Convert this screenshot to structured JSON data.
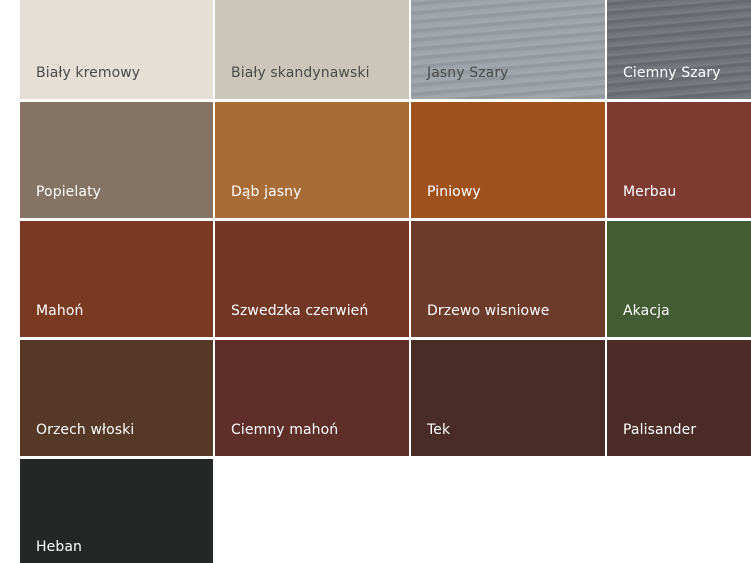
{
  "swatches": [
    {
      "name": "Biały kremowy",
      "color": "#e6dfd5",
      "text_color": "#4a4a4a"
    },
    {
      "name": "Biały skandynawski",
      "color": "#cbc5ba",
      "text_color": "#4a4a4a"
    },
    {
      "name": "Jasny Szary",
      "color": "#9aa0a6",
      "text_color": "#4a4a4a"
    },
    {
      "name": "Ciemny Szary",
      "color": "#6c7075",
      "text_color": "#ffffff"
    },
    {
      "name": "Popielaty",
      "color": "#857364",
      "text_color": "#ffffff"
    },
    {
      "name": "Dąb jasny",
      "color": "#a86c36",
      "text_color": "#ffffff"
    },
    {
      "name": "Piniowy",
      "color": "#a0521d",
      "text_color": "#ffffff"
    },
    {
      "name": "Merbau",
      "color": "#7d3b32",
      "text_color": "#ffffff"
    },
    {
      "name": "Mahoń",
      "color": "#7a3a22",
      "text_color": "#ffffff"
    },
    {
      "name": "Szwedzka czerwień",
      "color": "#733726",
      "text_color": "#ffffff"
    },
    {
      "name": "Drzewo wisniowe",
      "color": "#6c3b29",
      "text_color": "#ffffff"
    },
    {
      "name": "Akacja",
      "color": "#445c33",
      "text_color": "#ffffff"
    },
    {
      "name": "Orzech włoski",
      "color": "#563826",
      "text_color": "#ffffff"
    },
    {
      "name": "Ciemny mahoń",
      "color": "#5d2f28",
      "text_color": "#ffffff"
    },
    {
      "name": "Tek",
      "color": "#4a2c26",
      "text_color": "#ffffff"
    },
    {
      "name": "Palisander",
      "color": "#4a2b26",
      "text_color": "#ffffff"
    },
    {
      "name": "Heban",
      "color": "#252727",
      "text_color": "#ffffff"
    }
  ]
}
